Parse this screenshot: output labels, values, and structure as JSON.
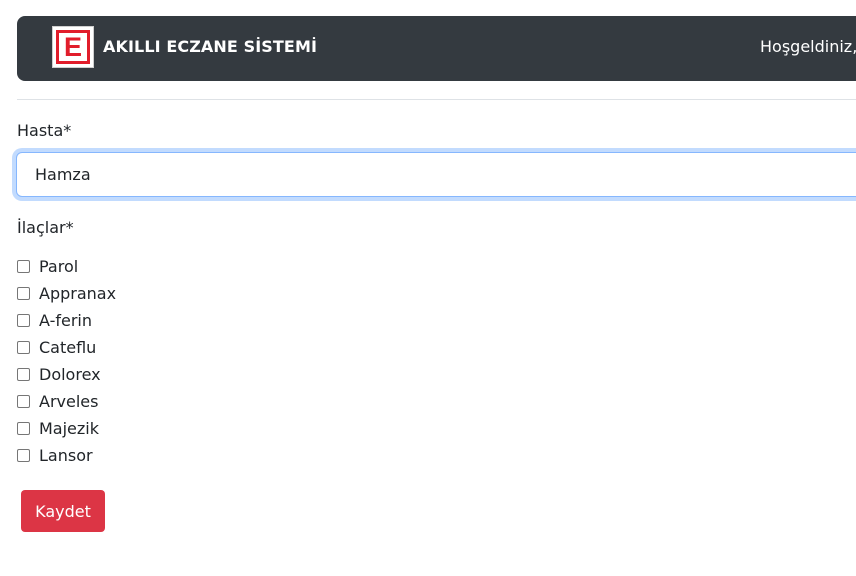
{
  "navbar": {
    "logo_letter": "E",
    "brand_name": "AKILLI ECZANE SİSTEMİ",
    "welcome_text": "Hoşgeldiniz,"
  },
  "form": {
    "patient_label": "Hasta*",
    "patient_value": "Hamza",
    "medications_label": "İlaçlar*",
    "medications": [
      {
        "label": "Parol",
        "checked": false
      },
      {
        "label": "Appranax",
        "checked": false
      },
      {
        "label": "A-ferin",
        "checked": false
      },
      {
        "label": "Cateflu",
        "checked": false
      },
      {
        "label": "Dolorex",
        "checked": false
      },
      {
        "label": "Arveles",
        "checked": false
      },
      {
        "label": "Majezik",
        "checked": false
      },
      {
        "label": "Lansor",
        "checked": false
      }
    ],
    "save_label": "Kaydet"
  },
  "colors": {
    "navbar_bg": "#343a40",
    "logo_red": "#e11d2b",
    "button_danger": "#dc3545",
    "input_focus_border": "#86b7fe"
  },
  "icons": {
    "logo": "pharmacy-e-logo-icon"
  }
}
